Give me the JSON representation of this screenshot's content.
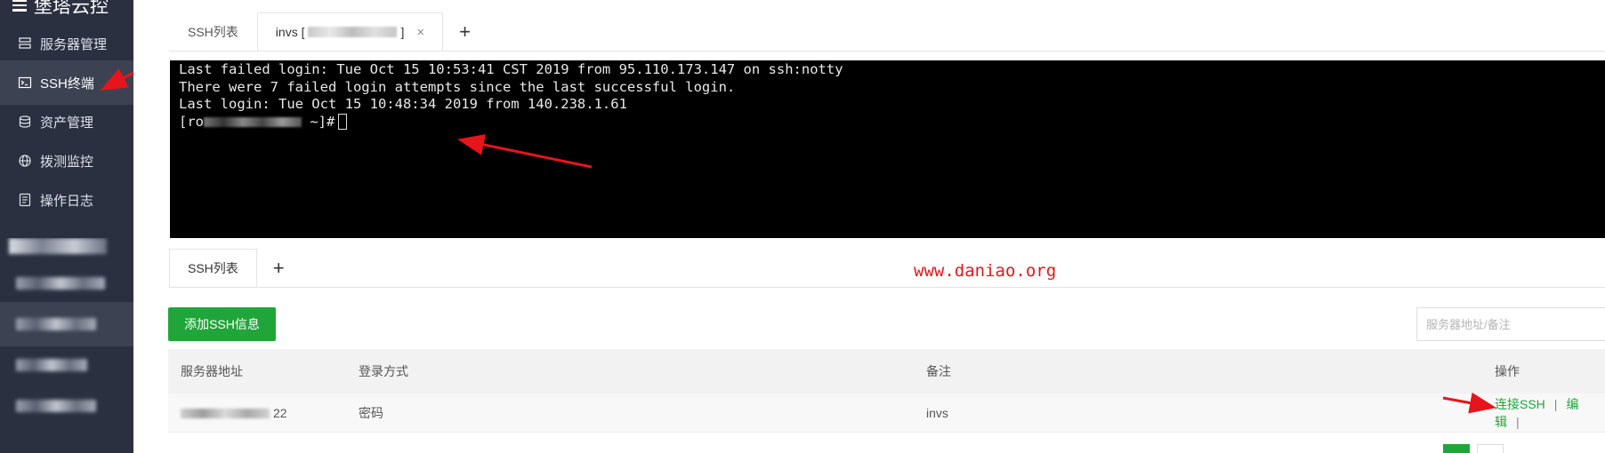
{
  "top": {
    "brand": "堡塔云控",
    "nav": [
      {
        "label": "服务器管理",
        "icon": "server-icon"
      },
      {
        "label": "SSH终端",
        "icon": "terminal-icon"
      },
      {
        "label": "资产管理",
        "icon": "database-icon"
      },
      {
        "label": "拨测监控",
        "icon": "globe-icon"
      },
      {
        "label": "操作日志",
        "icon": "log-icon"
      }
    ],
    "tabs": [
      {
        "label": "SSH列表"
      },
      {
        "label_prefix": "invs [",
        "label_suffix": "]",
        "close": "×"
      }
    ],
    "add_tab": "+",
    "terminal": {
      "lines": [
        "Last failed login: Tue Oct 15 10:53:41 CST 2019 from 95.110.173.147 on ssh:notty",
        "There were 7 failed login attempts since the last successful login.",
        "Last login: Tue Oct 15 10:48:34 2019 from 140.238.1.61"
      ],
      "prompt_prefix": "[ro",
      "prompt_suffix": " ~]#"
    }
  },
  "bottom": {
    "tabs": [
      {
        "label": "SSH列表"
      }
    ],
    "add_tab": "+",
    "watermark": "www.daniao.org",
    "add_button": "添加SSH信息",
    "search_placeholder": "服务器地址/备注",
    "table": {
      "headers": [
        "服务器地址",
        "登录方式",
        "备注",
        "操作"
      ],
      "rows": [
        {
          "address_suffix": "22",
          "login": "密码",
          "note": "invs",
          "actions": [
            "连接SSH",
            "编辑"
          ]
        }
      ]
    },
    "separator": "|"
  },
  "colors": {
    "sidebar": "#2b3041",
    "sidebar_active": "#3c4252",
    "accent_green": "#20a53a",
    "annotation_red": "#e8141b"
  }
}
